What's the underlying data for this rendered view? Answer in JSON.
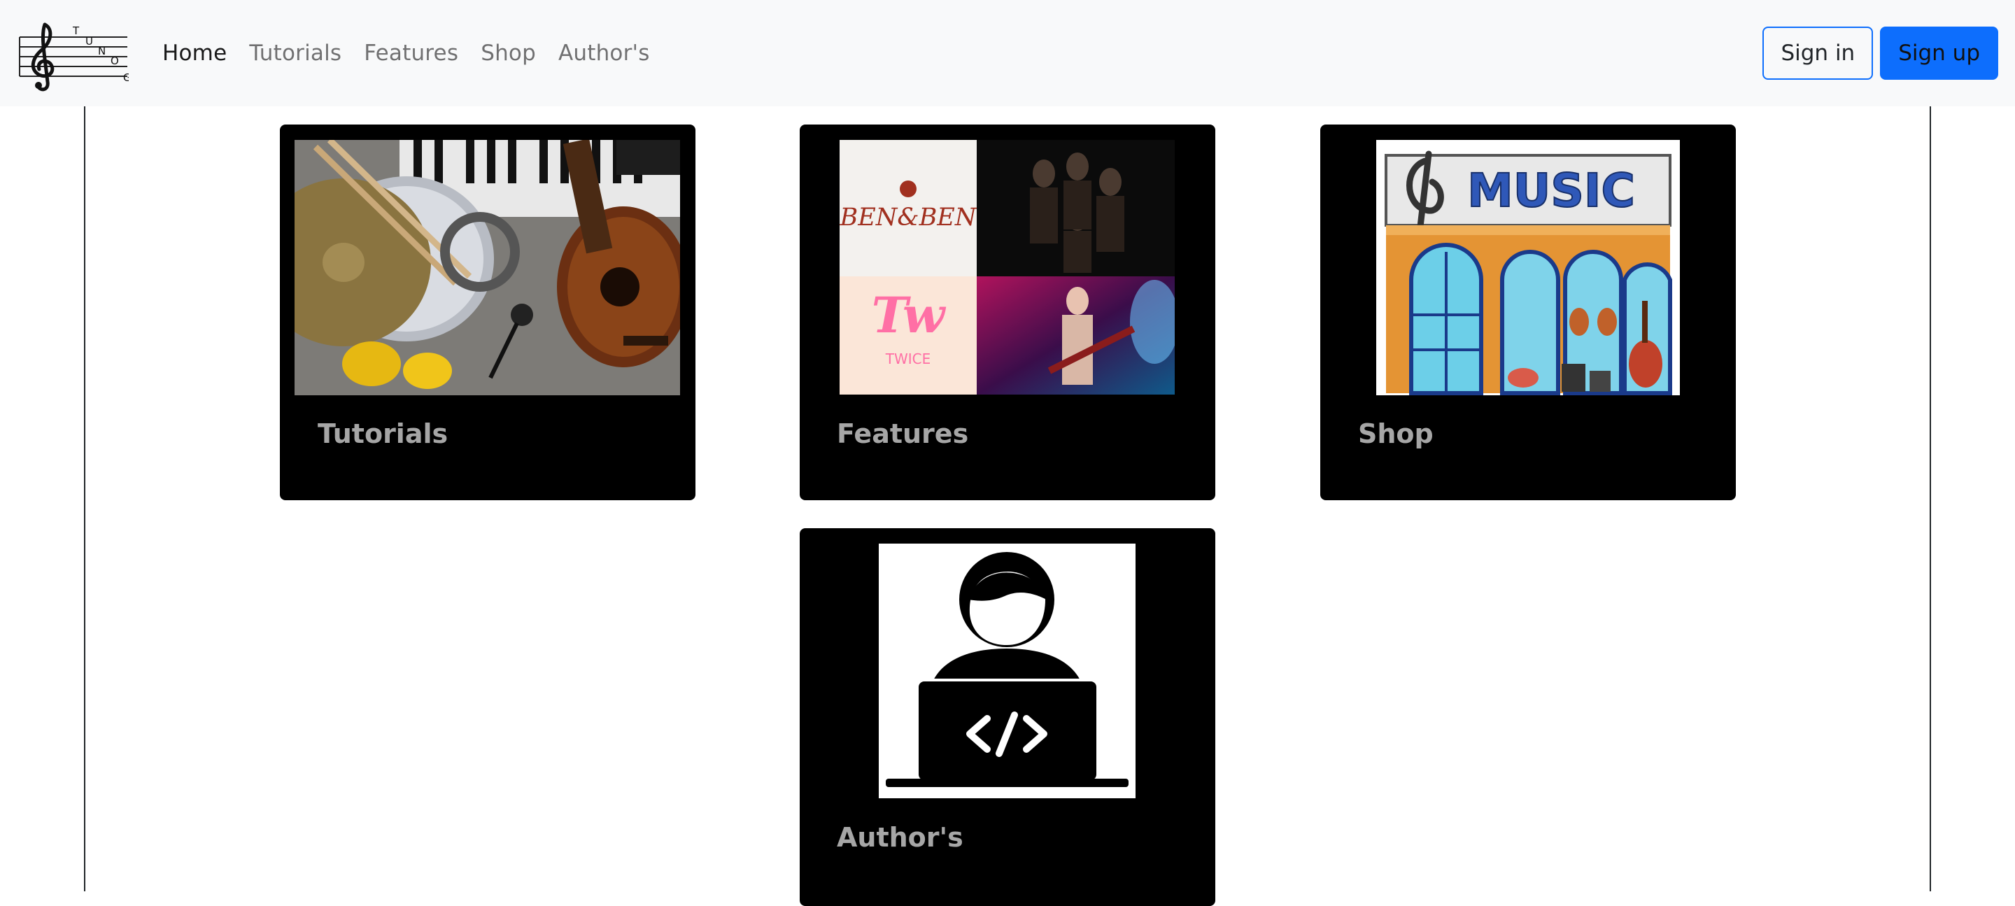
{
  "navbar": {
    "brand": {
      "letters": [
        "T",
        "U",
        "N",
        "O",
        "G"
      ],
      "logo_icon": "treble-clef-staff-icon"
    },
    "links": [
      {
        "label": "Home",
        "active": true
      },
      {
        "label": "Tutorials",
        "active": false
      },
      {
        "label": "Features",
        "active": false
      },
      {
        "label": "Shop",
        "active": false
      },
      {
        "label": "Author's",
        "active": false
      }
    ],
    "sign_in_label": "Sign in",
    "sign_up_label": "Sign up"
  },
  "cards": {
    "tutorials": {
      "title": "Tutorials",
      "image": "musical-instruments-photo"
    },
    "features": {
      "title": "Features",
      "image": "artist-collage",
      "collage": {
        "band_logo_text": "BEN&BEN",
        "group_logo_text": "TWICE"
      }
    },
    "shop": {
      "title": "Shop",
      "image": "music-store-illustration",
      "sign_text": "MUSIC"
    },
    "authors": {
      "title": "Author's",
      "image": "developer-at-laptop-icon"
    }
  },
  "colors": {
    "navbar_bg": "#f8f9fa",
    "primary": "#0d6efd",
    "card_bg": "#000000",
    "card_title": "#a6a6a6"
  }
}
